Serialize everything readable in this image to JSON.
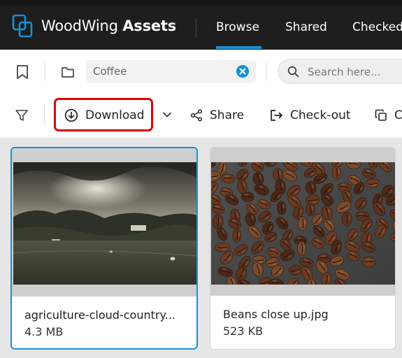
{
  "header": {
    "brand_light": "WoodWing",
    "brand_bold": "Assets",
    "nav": [
      "Browse",
      "Shared",
      "Checked"
    ]
  },
  "search_row": {
    "folder_value": "Coffee",
    "search_placeholder": "Search here..."
  },
  "toolbar": {
    "download_label": "Download",
    "share_label": "Share",
    "checkout_label": "Check-out",
    "copy_label": "C"
  },
  "assets": [
    {
      "name": "agriculture-cloud-country...",
      "size": "4.3 MB",
      "selected": true
    },
    {
      "name": "Beans close up.jpg",
      "size": "523 KB",
      "selected": false
    }
  ],
  "colors": {
    "accent": "#1591d6",
    "highlight": "#e00000",
    "header_bg": "#1e1e1e"
  }
}
